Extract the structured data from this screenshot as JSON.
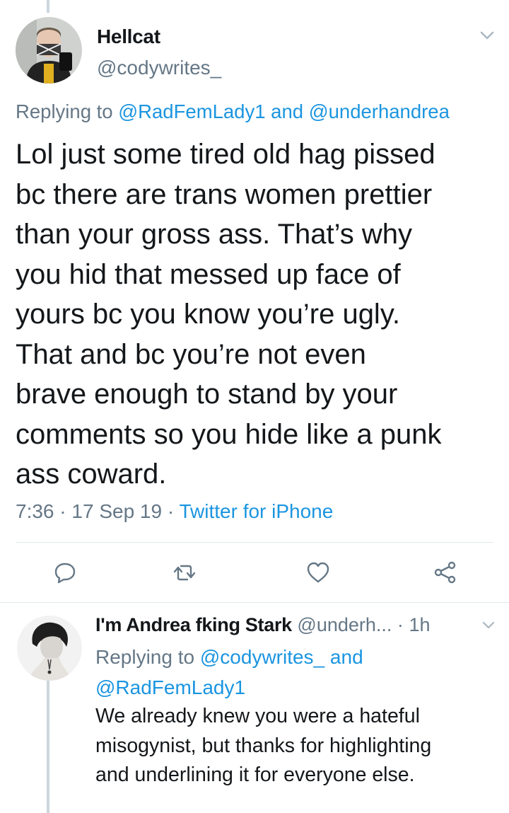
{
  "main_tweet": {
    "display_name": "Hellcat",
    "handle": "@codywrites_",
    "replying_prefix": "Replying to",
    "replying_user1": "@RadFemLady1",
    "replying_and": "and",
    "replying_user2": "@underhandrea",
    "text_lines": [
      "Lol just some tired old hag pissed",
      "bc there are trans women prettier",
      "than your gross ass. That’s why",
      "you hid that messed up face of",
      "yours bc you know you’re ugly.",
      "That and bc you’re not even",
      "brave enough to stand by your",
      "comments so you hide like a punk",
      "ass coward."
    ],
    "time": "7:36",
    "sep": "·",
    "date": "17 Sep 19",
    "source": "Twitter for iPhone"
  },
  "reply_tweet": {
    "display_name": "I'm Andrea fking Stark",
    "handle": "@underh...",
    "time_sep": "·",
    "time": "1h",
    "replying_prefix": "Replying to",
    "replying_user1": "@codywrites_",
    "replying_and": "and",
    "replying_user2": "@RadFemLady1",
    "text_lines": [
      "We already knew you were a hateful",
      "misogynist, but thanks for highlighting",
      "and underlining it for everyone else."
    ]
  },
  "colors": {
    "link": "#1b95e0",
    "secondary": "#657786",
    "divider": "#e1e8ed",
    "thread_line": "#ccd6dd"
  },
  "icons": [
    "chevron-down-icon",
    "reply-icon",
    "retweet-icon",
    "like-icon",
    "share-icon"
  ]
}
